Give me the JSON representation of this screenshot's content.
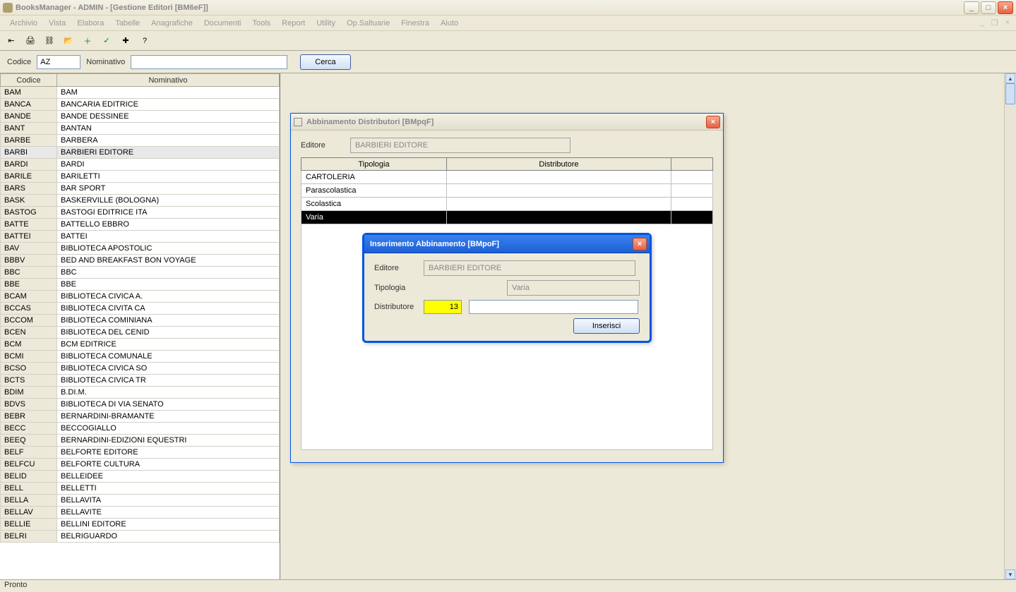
{
  "window": {
    "title": "BooksManager - ADMIN - [Gestione Editori  [BM6eF]]"
  },
  "menu": [
    "Archivio",
    "Vista",
    "Elabora",
    "Tabelle",
    "Anagrafiche",
    "Documenti",
    "Tools",
    "Report",
    "Utility",
    "Op.Saltuarie",
    "Finestra",
    "Aiuto"
  ],
  "search": {
    "codice_label": "Codice",
    "codice_value": "AZ",
    "nominativo_label": "Nominativo",
    "nominativo_value": "",
    "cerca_label": "Cerca"
  },
  "columns": {
    "codice": "Codice",
    "nominativo": "Nominativo"
  },
  "rows": [
    {
      "c": "BAM",
      "n": "BAM"
    },
    {
      "c": "BANCA",
      "n": "BANCARIA EDITRICE"
    },
    {
      "c": "BANDE",
      "n": "BANDE DESSINEE"
    },
    {
      "c": "BANT",
      "n": "BANTAN"
    },
    {
      "c": "BARBE",
      "n": "BARBERA"
    },
    {
      "c": "BARBI",
      "n": "BARBIERI EDITORE",
      "sel": true
    },
    {
      "c": "BARDI",
      "n": "BARDI"
    },
    {
      "c": "BARILE",
      "n": "BARILETTI"
    },
    {
      "c": "BARS",
      "n": "BAR SPORT"
    },
    {
      "c": "BASK",
      "n": "BASKERVILLE (BOLOGNA)"
    },
    {
      "c": "BASTOG",
      "n": "BASTOGI EDITRICE ITA"
    },
    {
      "c": "BATTE",
      "n": "BATTELLO EBBRO"
    },
    {
      "c": "BATTEI",
      "n": "BATTEI"
    },
    {
      "c": "BAV",
      "n": "BIBLIOTECA APOSTOLIC"
    },
    {
      "c": "BBBV",
      "n": "BED AND BREAKFAST BON VOYAGE"
    },
    {
      "c": "BBC",
      "n": "BBC"
    },
    {
      "c": "BBE",
      "n": "BBE"
    },
    {
      "c": "BCAM",
      "n": "BIBLIOTECA CIVICA A."
    },
    {
      "c": "BCCAS",
      "n": "BIBLIOTECA CIVITA CA"
    },
    {
      "c": "BCCOM",
      "n": "BIBLIOTECA COMINIANA"
    },
    {
      "c": "BCEN",
      "n": "BIBLIOTECA DEL CENID"
    },
    {
      "c": "BCM",
      "n": "BCM EDITRICE"
    },
    {
      "c": "BCMI",
      "n": "BIBLIOTECA COMUNALE"
    },
    {
      "c": "BCSO",
      "n": "BIBLIOTECA CIVICA SO"
    },
    {
      "c": "BCTS",
      "n": "BIBLIOTECA CIVICA TR"
    },
    {
      "c": "BDIM",
      "n": "B.DI.M."
    },
    {
      "c": "BDVS",
      "n": "BIBLIOTECA DI VIA SENATO"
    },
    {
      "c": "BEBR",
      "n": "BERNARDINI-BRAMANTE"
    },
    {
      "c": "BECC",
      "n": "BECCOGIALLO"
    },
    {
      "c": "BEEQ",
      "n": "BERNARDINI-EDIZIONI EQUESTRI"
    },
    {
      "c": "BELF",
      "n": "BELFORTE EDITORE"
    },
    {
      "c": "BELFCU",
      "n": "BELFORTE CULTURA"
    },
    {
      "c": "BELID",
      "n": "BELLEIDEE"
    },
    {
      "c": "BELL",
      "n": "BELLETTI"
    },
    {
      "c": "BELLA",
      "n": "BELLAVITA"
    },
    {
      "c": "BELLAV",
      "n": "BELLAVITE"
    },
    {
      "c": "BELLIE",
      "n": "BELLINI EDITORE"
    },
    {
      "c": "BELRI",
      "n": "BELRIGUARDO"
    }
  ],
  "dlg1": {
    "title": "Abbinamento Distributori  [BMpqF]",
    "editore_label": "Editore",
    "editore_value": "BARBIERI EDITORE",
    "cols": {
      "tipologia": "Tipologia",
      "distributore": "Distributore"
    },
    "rows": [
      {
        "t": "CARTOLERIA",
        "d": ""
      },
      {
        "t": "Parascolastica",
        "d": ""
      },
      {
        "t": "Scolastica",
        "d": ""
      },
      {
        "t": "Varia",
        "d": "",
        "hlt": true
      }
    ]
  },
  "dlg2": {
    "title": "Inserimento Abbinamento  [BMpoF]",
    "editore_label": "Editore",
    "editore_value": "BARBIERI EDITORE",
    "tipologia_label": "Tipologia",
    "tipologia_value": "Varia",
    "distributore_label": "Distributore",
    "distributore_code": "13",
    "distributore_name": "",
    "inserisci_label": "Inserisci"
  },
  "status": "Pronto"
}
